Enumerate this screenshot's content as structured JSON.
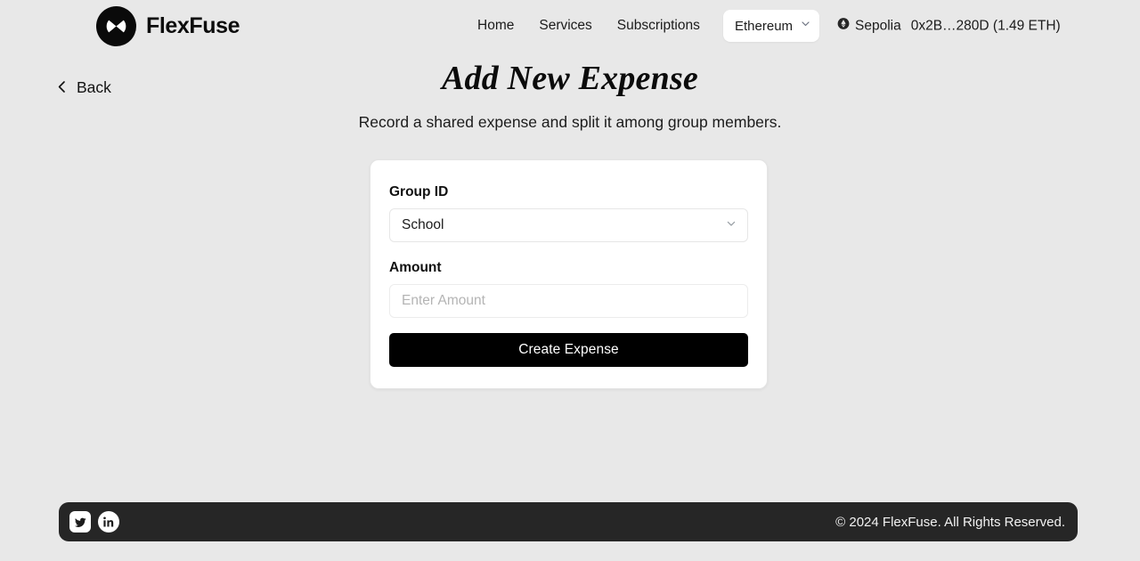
{
  "header": {
    "brand": {
      "name": "FlexFuse",
      "logo_icon": "flexfuse-logo-icon"
    },
    "nav": [
      {
        "label": "Home",
        "name": "nav-link-home"
      },
      {
        "label": "Services",
        "name": "nav-link-services"
      },
      {
        "label": "Subscriptions",
        "name": "nav-link-subscriptions"
      }
    ],
    "network_select": {
      "value": "Ethereum",
      "chevron_icon": "chevron-down-icon"
    },
    "wallet": {
      "chain_icon": "ethereum-network-icon",
      "chain": "Sepolia",
      "address": "0x2B…280D (1.49 ETH)"
    }
  },
  "back": {
    "label": "Back",
    "icon": "chevron-left-icon"
  },
  "hero": {
    "title": "Add New Expense",
    "subtitle": "Record a shared expense and split it among group members."
  },
  "form": {
    "group": {
      "label": "Group ID",
      "value": "School",
      "chevron_icon": "chevron-down-icon"
    },
    "amount": {
      "label": "Amount",
      "value": "",
      "placeholder": "Enter Amount"
    },
    "submit_label": "Create Expense"
  },
  "footer": {
    "socials": [
      {
        "name": "twitter-icon",
        "label": "Twitter"
      },
      {
        "name": "linkedin-icon",
        "label": "LinkedIn"
      }
    ],
    "copyright": "© 2024 FlexFuse. All Rights Reserved."
  },
  "colors": {
    "page_background": "#e8e8e8",
    "card_background": "#ffffff",
    "accent_dark": "#000000",
    "footer_background": "#262626",
    "text_primary": "#111111",
    "placeholder": "#b4b4b4"
  }
}
